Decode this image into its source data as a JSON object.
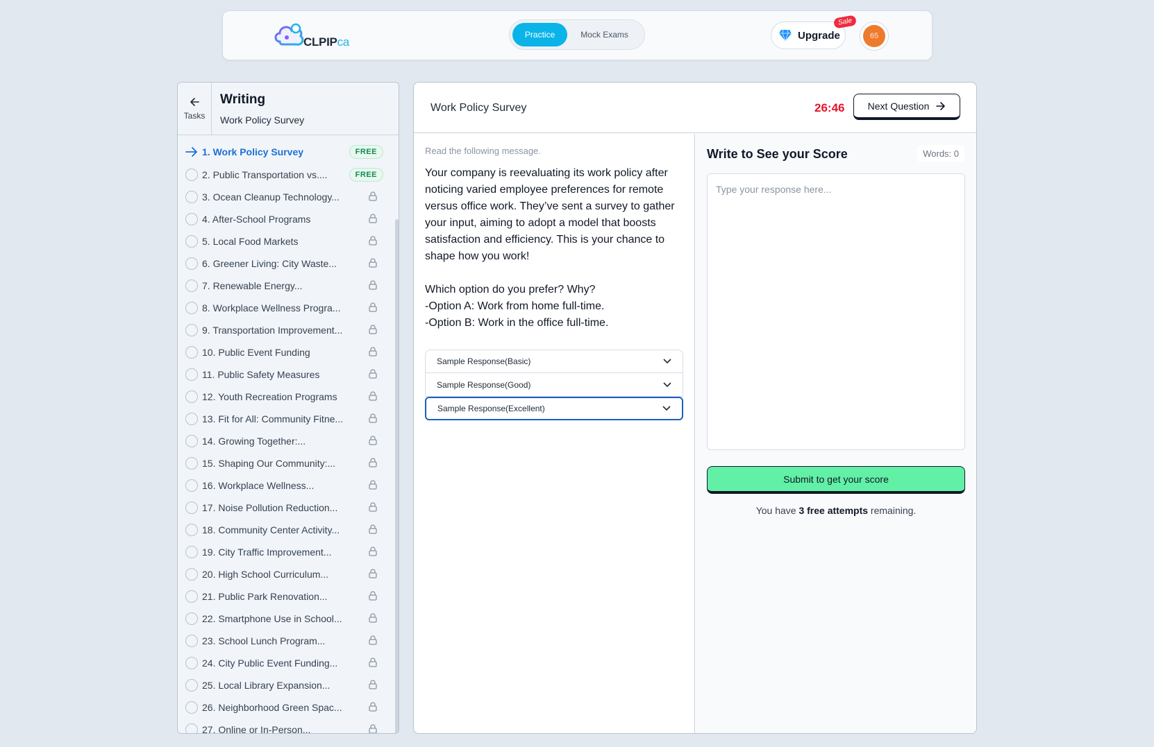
{
  "header": {
    "logo_text": "CLPIP",
    "logo_suffix": "ca",
    "tabs": [
      {
        "label": "Practice",
        "active": true
      },
      {
        "label": "Mock Exams",
        "active": false
      }
    ],
    "upgrade_label": "Upgrade",
    "sale_badge": "Sale",
    "avatar_initials": "65",
    "accent_color": "#0ab4e8"
  },
  "sidebar": {
    "back_label": "Tasks",
    "section_title": "Writing",
    "section_subtitle": "Work Policy Survey",
    "free_badge": "FREE",
    "tasks": [
      {
        "label": "1. Work Policy Survey",
        "state": "active",
        "free": true
      },
      {
        "label": "2. Public Transportation vs....",
        "state": "open",
        "free": true
      },
      {
        "label": "3. Ocean Cleanup Technology...",
        "state": "locked"
      },
      {
        "label": "4. After-School Programs",
        "state": "locked"
      },
      {
        "label": "5. Local Food Markets",
        "state": "locked"
      },
      {
        "label": "6. Greener Living: City Waste...",
        "state": "locked"
      },
      {
        "label": "7. Renewable Energy...",
        "state": "locked"
      },
      {
        "label": "8. Workplace Wellness Progra...",
        "state": "locked"
      },
      {
        "label": "9. Transportation Improvement...",
        "state": "locked"
      },
      {
        "label": "10. Public Event Funding",
        "state": "locked"
      },
      {
        "label": "11. Public Safety Measures",
        "state": "locked"
      },
      {
        "label": "12. Youth Recreation Programs",
        "state": "locked"
      },
      {
        "label": "13. Fit for All: Community Fitne...",
        "state": "locked"
      },
      {
        "label": "14. Growing Together:...",
        "state": "locked"
      },
      {
        "label": "15. Shaping Our Community:...",
        "state": "locked"
      },
      {
        "label": "16. Workplace Wellness...",
        "state": "locked"
      },
      {
        "label": "17. Noise Pollution Reduction...",
        "state": "locked"
      },
      {
        "label": "18. Community Center Activity...",
        "state": "locked"
      },
      {
        "label": "19. City Traffic Improvement...",
        "state": "locked"
      },
      {
        "label": "20. High School Curriculum...",
        "state": "locked"
      },
      {
        "label": "21. Public Park Renovation...",
        "state": "locked"
      },
      {
        "label": "22. Smartphone Use in School...",
        "state": "locked"
      },
      {
        "label": "23. School Lunch Program...",
        "state": "locked"
      },
      {
        "label": "24. City Public Event Funding...",
        "state": "locked"
      },
      {
        "label": "25. Local Library Expansion...",
        "state": "locked"
      },
      {
        "label": "26. Neighborhood Green Spac...",
        "state": "locked"
      },
      {
        "label": "27. Online or In-Person...",
        "state": "locked"
      }
    ]
  },
  "main": {
    "title": "Work Policy Survey",
    "timer": "26:46",
    "next_label": "Next Question",
    "instruction": "Read the following message.",
    "prompt": "Your company is reevaluating its work policy after noticing varied employee preferences for remote versus office work. They’ve sent a survey to gather your input, aiming to adopt a model that boosts satisfaction and efficiency. This is your chance to shape how you work!\n\nWhich option do you prefer? Why?\n-Option A: Work from home full-time.\n-Option B: Work in the office full-time.",
    "samples": [
      {
        "label": "Sample Response(Basic)",
        "focused": false
      },
      {
        "label": "Sample Response(Good)",
        "focused": false
      },
      {
        "label": "Sample Response(Excellent)",
        "focused": true
      }
    ],
    "write_title": "Write to See your Score",
    "word_count": "Words: 0",
    "response_placeholder": "Type your response here...",
    "response_value": "",
    "submit_label": "Submit to get your score",
    "attempts_prefix": "You have ",
    "attempts_bold": "3 free attempts",
    "attempts_suffix": " remaining."
  }
}
